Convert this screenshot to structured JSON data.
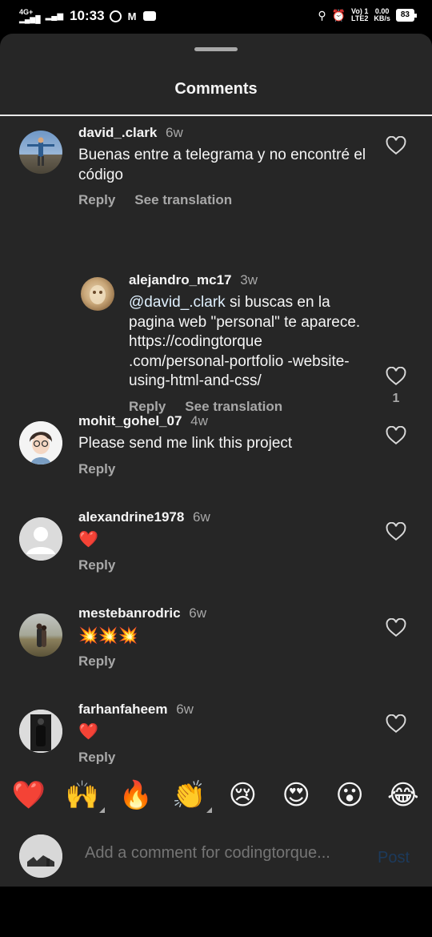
{
  "status_bar": {
    "network": "4G+",
    "time": "10:33",
    "volte": "Vo) 1",
    "lte": "LTE2",
    "speed": "0.00",
    "speed_unit": "KB/s",
    "battery": "83"
  },
  "sheet": {
    "title": "Comments"
  },
  "comments": [
    {
      "username": "david_.clark",
      "time": "6w",
      "text": "Buenas entre a telegrama y no encontré el código",
      "reply": "Reply",
      "translate": "See translation"
    },
    {
      "username": "alejandro_mc17",
      "time": "3w",
      "mention": "@david_.clark",
      "text": " si buscas en la pagina web \"personal\" te aparece. https://codingtorque .com/personal-portfolio -website-using-html-and-css/",
      "reply": "Reply",
      "translate": "See translation",
      "likes": "1"
    },
    {
      "username": "mohit_gohel_07",
      "time": "4w",
      "text": "Please send me link this project",
      "reply": "Reply"
    },
    {
      "username": "alexandrine1978",
      "time": "6w",
      "text": "❤️",
      "reply": "Reply"
    },
    {
      "username": "mestebanrodric",
      "time": "6w",
      "text": "💥💥💥",
      "reply": "Reply"
    },
    {
      "username": "farhanfaheem",
      "time": "6w",
      "text": "❤️",
      "reply": "Reply"
    }
  ],
  "reactions": [
    "❤️",
    "🙌",
    "🔥",
    "👏",
    "😢",
    "😍",
    "😮",
    "😂"
  ],
  "input": {
    "placeholder": "Add a comment for codingtorque...",
    "post_label": "Post"
  },
  "icons": {
    "like": "heart-outline-icon"
  },
  "colors": {
    "sheet_bg": "#262626",
    "secondary_text": "#a8a8a8",
    "post_disabled": "#1c3a5c"
  }
}
